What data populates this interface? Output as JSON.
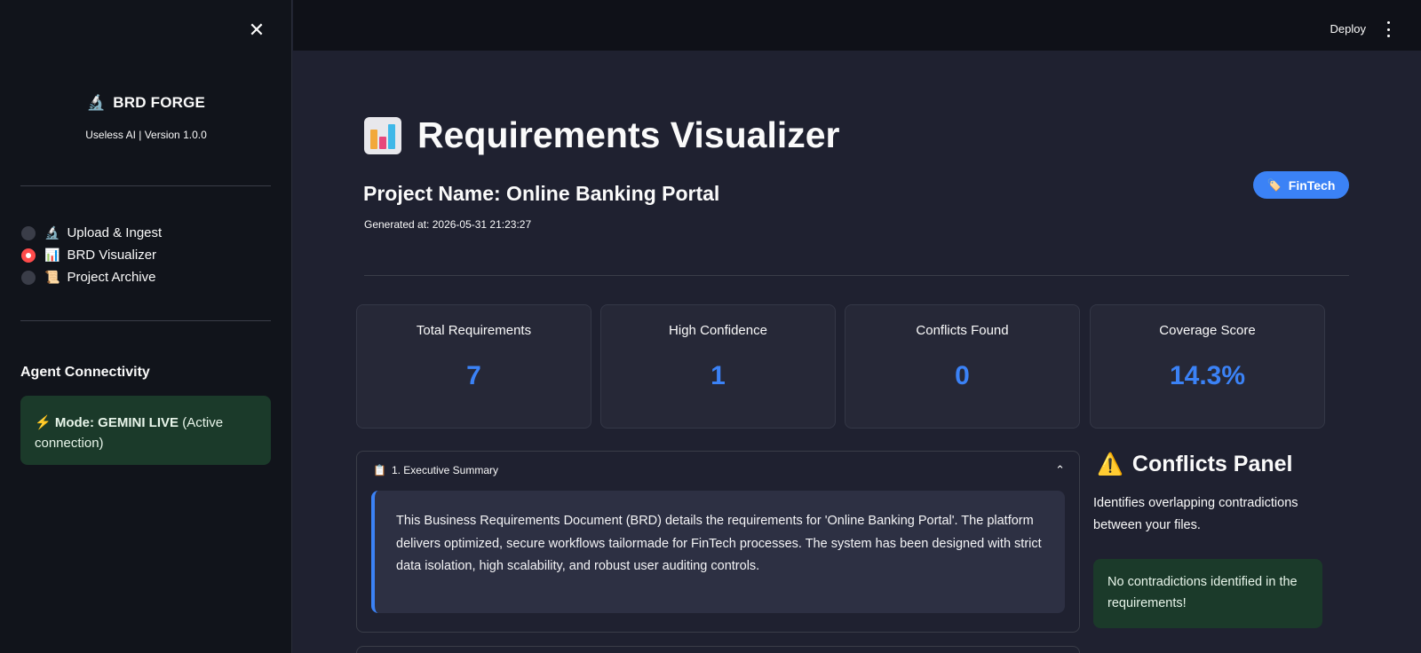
{
  "sidebar": {
    "close_symbol": "✕",
    "brand": {
      "emoji": "🔬",
      "title": "BRD FORGE",
      "subtitle": "Useless AI | Version 1.0.0"
    },
    "nav": [
      {
        "emoji": "🔬",
        "label": "Upload & Ingest",
        "selected": false
      },
      {
        "emoji": "📊",
        "label": "BRD Visualizer",
        "selected": true
      },
      {
        "emoji": "📜",
        "label": "Project Archive",
        "selected": false
      }
    ],
    "agent": {
      "title": "Agent Connectivity",
      "emoji": "⚡",
      "mode_label": "Mode: GEMINI LIVE",
      "mode_note": "(Active connection)"
    }
  },
  "header": {
    "deploy_label": "Deploy"
  },
  "main": {
    "title": "Requirements Visualizer",
    "project_name": "Project Name: Online Banking Portal",
    "generated_at": "Generated at: 2026-05-31 21:23:27",
    "badge": {
      "emoji": "🏷️",
      "label": "FinTech"
    },
    "metrics": [
      {
        "label": "Total Requirements",
        "value": "7"
      },
      {
        "label": "High Confidence",
        "value": "1"
      },
      {
        "label": "Conflicts Found",
        "value": "0"
      },
      {
        "label": "Coverage Score",
        "value": "14.3%"
      }
    ],
    "executive_summary": {
      "emoji": "📋",
      "title": "1. Executive Summary",
      "text": "This Business Requirements Document (BRD) details the requirements for 'Online Banking Portal'. The platform delivers optimized, secure workflows tailormade for FinTech processes. The system has been designed with strict data isolation, high scalability, and robust user auditing controls."
    },
    "conflicts": {
      "emoji": "⚠️",
      "title": "Conflicts Panel",
      "description": "Identifies overlapping contradictions between your files.",
      "status": "No contradictions identified in the requirements!"
    }
  },
  "colors": {
    "accent": "#3b82f6",
    "selected_radio": "#ff4b4b",
    "success_bg": "#1b3a2a",
    "sidebar_bg": "#11141b",
    "main_bg": "#1f2130"
  },
  "icons": {
    "close": "close-icon",
    "kebab": "kebab-menu-icon",
    "chevron": "chevron-up-icon",
    "chart": "bar-chart-icon"
  }
}
